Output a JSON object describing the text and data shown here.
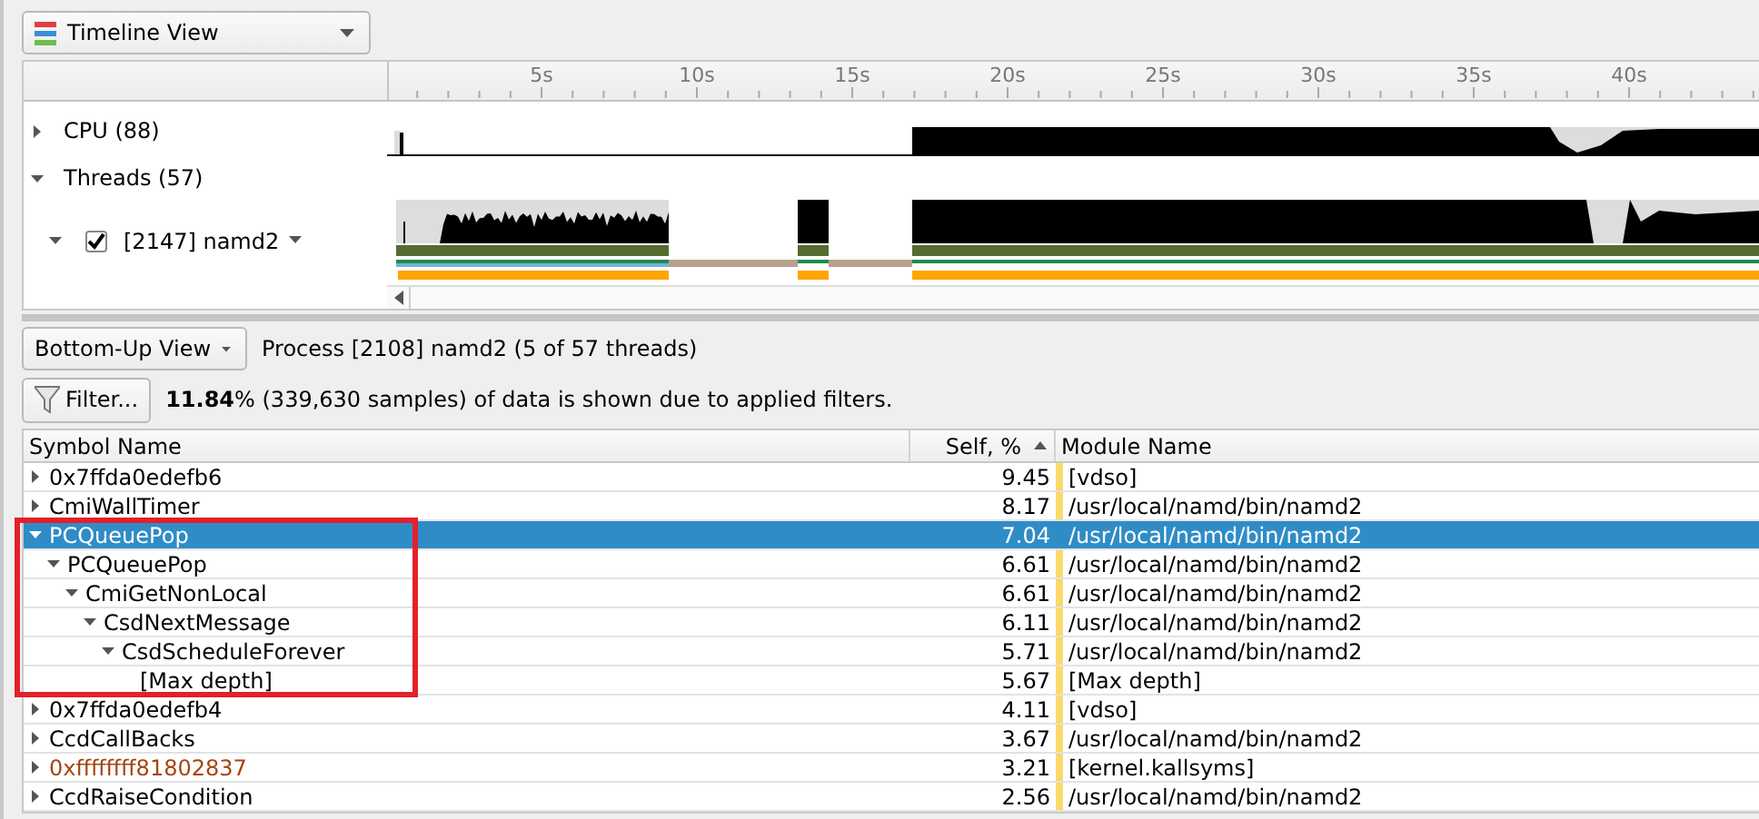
{
  "view_selector": {
    "label": "Timeline View"
  },
  "timeline": {
    "ruler_labels": [
      "5s",
      "10s",
      "15s",
      "20s",
      "25s",
      "30s",
      "35s",
      "40s"
    ],
    "tracks": [
      {
        "kind": "group",
        "label": "CPU (88)",
        "expanded": false
      },
      {
        "kind": "group",
        "label": "Threads (57)",
        "expanded": true
      },
      {
        "kind": "thread",
        "label": "[2147] namd2",
        "expanded": true,
        "checked": true
      }
    ]
  },
  "analysis": {
    "view_selector": {
      "label": "Bottom-Up View"
    },
    "process_info": "Process [2108] namd2 (5 of 57 threads)"
  },
  "filter": {
    "button": "Filter...",
    "message": "**11.84**% (339,630 samples) of data is shown due to applied filters."
  },
  "table": {
    "columns": [
      "Symbol Name",
      "Self, %",
      "Module Name"
    ],
    "rows": [
      {
        "symbol": "0x7ffda0edefb6",
        "self": "9.45",
        "module": "[vdso]",
        "kind": "user",
        "expanded": false,
        "selected": false
      },
      {
        "symbol": "CmiWallTimer",
        "self": "8.17",
        "module": "/usr/local/namd/bin/namd2",
        "kind": "user",
        "expanded": false,
        "selected": false
      },
      {
        "symbol": "PCQueuePop",
        "self": "7.04",
        "module": "/usr/local/namd/bin/namd2",
        "kind": "user",
        "expanded": true,
        "selected": true,
        "children": [
          {
            "symbol": "PCQueuePop",
            "self": "6.61",
            "module": "/usr/local/namd/bin/namd2",
            "kind": "user",
            "expanded": true,
            "selected": false,
            "children": [
              {
                "symbol": "CmiGetNonLocal",
                "self": "6.61",
                "module": "/usr/local/namd/bin/namd2",
                "kind": "user",
                "expanded": true,
                "selected": false,
                "children": [
                  {
                    "symbol": "CsdNextMessage",
                    "self": "6.11",
                    "module": "/usr/local/namd/bin/namd2",
                    "kind": "user",
                    "expanded": true,
                    "selected": false,
                    "children": [
                      {
                        "symbol": "CsdScheduleForever",
                        "self": "5.71",
                        "module": "/usr/local/namd/bin/namd2",
                        "kind": "user",
                        "expanded": true,
                        "selected": false,
                        "children": [
                          {
                            "symbol": "[Max depth]",
                            "self": "5.67",
                            "module": "[Max depth]",
                            "kind": "user",
                            "selected": false
                          }
                        ]
                      }
                    ]
                  }
                ]
              }
            ]
          }
        ]
      },
      {
        "symbol": "0x7ffda0edefb4",
        "self": "4.11",
        "module": "[vdso]",
        "kind": "user",
        "expanded": false,
        "selected": false
      },
      {
        "symbol": "CcdCallBacks",
        "self": "3.67",
        "module": "/usr/local/namd/bin/namd2",
        "kind": "user",
        "expanded": false,
        "selected": false
      },
      {
        "symbol": "0xffffffff81802837",
        "self": "3.21",
        "module": "[kernel.kallsyms]",
        "kind": "kernel",
        "expanded": false,
        "selected": false
      },
      {
        "symbol": "CcdRaiseCondition",
        "self": "2.56",
        "module": "/usr/local/namd/bin/namd2",
        "kind": "user",
        "expanded": false,
        "selected": false
      }
    ]
  },
  "annotation": {
    "kind": "rectangle"
  }
}
